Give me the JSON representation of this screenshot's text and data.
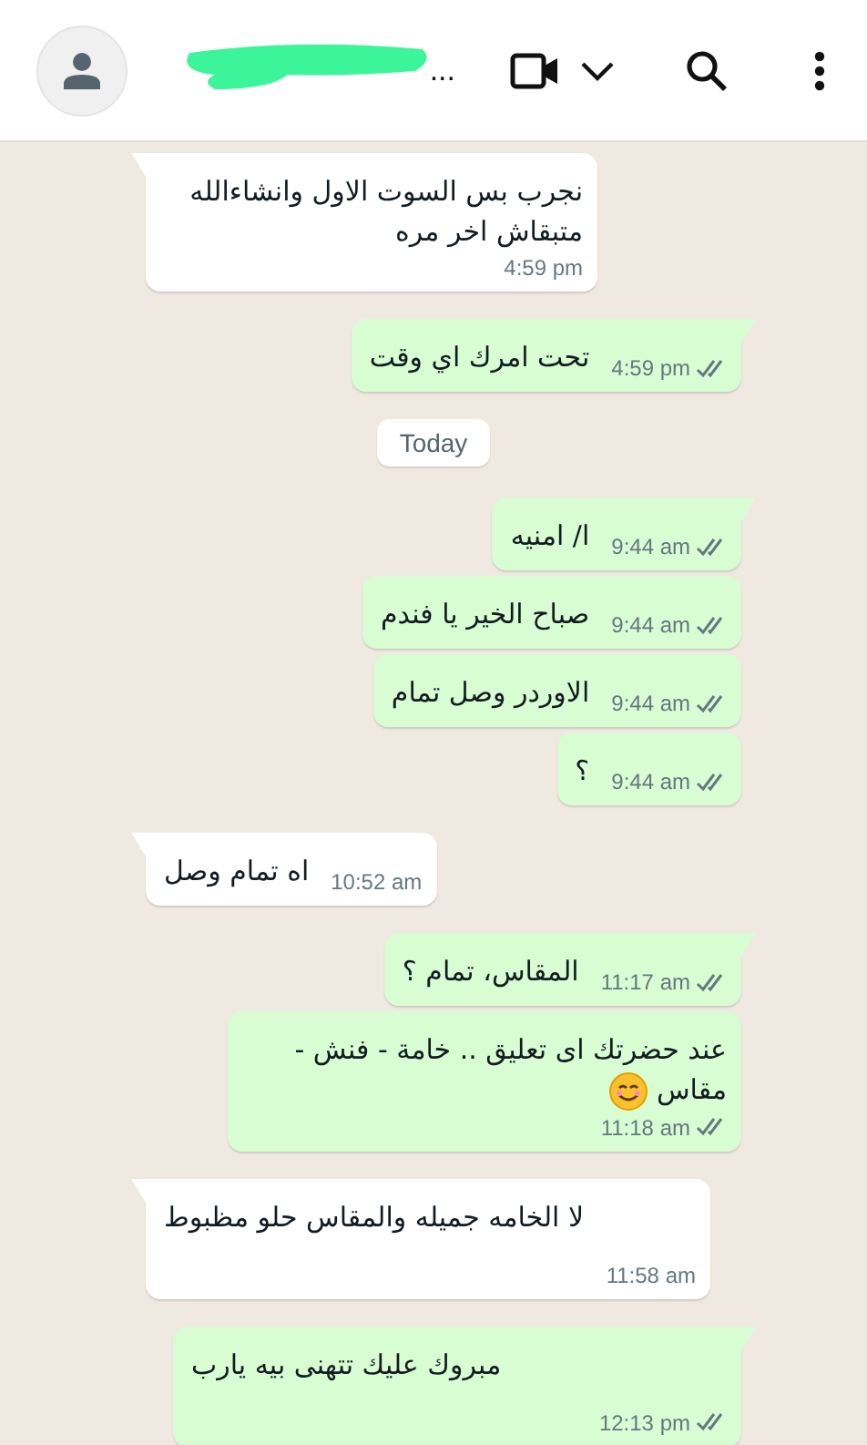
{
  "header": {
    "contact_name": "..."
  },
  "messages": [
    {
      "kind": "stacked",
      "outgoing": false,
      "tail": true,
      "text": "نجرب بس السوت الاول وانشاءالله متبقاش اخر مره",
      "time": "4:59 pm"
    },
    {
      "kind": "inline",
      "outgoing": true,
      "tail": true,
      "text": "تحت امرك اي وقت",
      "time": "4:59 pm",
      "read": false
    },
    {
      "kind": "date",
      "text": "Today"
    },
    {
      "kind": "inline",
      "outgoing": true,
      "tail": true,
      "text": "ا/ امنيه",
      "time": "9:44 am",
      "read": false
    },
    {
      "kind": "inline",
      "outgoing": true,
      "tail": false,
      "text": "صباح الخير يا فندم",
      "time": "9:44 am",
      "read": false
    },
    {
      "kind": "inline",
      "outgoing": true,
      "tail": false,
      "text": "الاوردر وصل تمام",
      "time": "9:44 am",
      "read": false
    },
    {
      "kind": "inline",
      "outgoing": true,
      "tail": false,
      "text": "؟",
      "time": "9:44 am",
      "read": false
    },
    {
      "kind": "inline",
      "outgoing": false,
      "tail": true,
      "text": "اه تمام وصل",
      "time": "10:52 am"
    },
    {
      "kind": "inline",
      "outgoing": true,
      "tail": true,
      "text": "المقاس، تمام ؟",
      "time": "11:17 am",
      "read": false
    },
    {
      "kind": "stacked",
      "outgoing": true,
      "tail": false,
      "text": "عند حضرتك اى تعليق .. خامة - فنش - مقاس",
      "emoji": true,
      "time": "11:18 am",
      "read": false
    },
    {
      "kind": "wide",
      "outgoing": false,
      "tail": true,
      "text": "لا الخامه جميله والمقاس حلو مظبوط",
      "time": "11:58 am"
    },
    {
      "kind": "wide",
      "outgoing": true,
      "tail": true,
      "text": "مبروك عليك تتهنى بيه يارب",
      "time": "12:13 pm",
      "read": false
    }
  ]
}
